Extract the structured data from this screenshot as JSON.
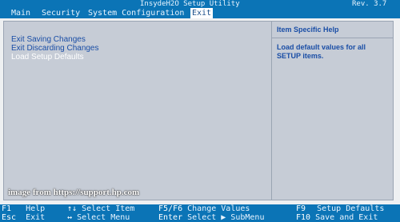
{
  "header": {
    "title": "InsydeH2O Setup Utility",
    "revision": "Rev. 3.7"
  },
  "menu": [
    "Main",
    "Security",
    "System Configuration",
    "Exit"
  ],
  "options": [
    "Exit Saving Changes",
    "Exit Discarding Changes",
    "Load Setup Defaults"
  ],
  "help": {
    "title": "Item Specific Help",
    "text": "Load default values for all SETUP items."
  },
  "watermark": "image from https://support.hp.com",
  "footer": {
    "row1": [
      {
        "key": "F1",
        "label": "Help"
      },
      {
        "key": "↑↓",
        "label": "Select Item"
      },
      {
        "key": "F5/F6",
        "label": "Change Values"
      },
      {
        "key": "F9",
        "label": "Setup Defaults"
      }
    ],
    "row2": [
      {
        "key": "Esc",
        "label": "Exit"
      },
      {
        "key": "↔",
        "label": "Select Menu"
      },
      {
        "key": "Enter",
        "label": "Select ▶ SubMenu"
      },
      {
        "key": "F10",
        "label": "Save and Exit"
      }
    ]
  },
  "colors": {
    "bar": "#0b74b6",
    "panel": "#c6ccd6",
    "accent_text": "#1a4ea6",
    "selected_text": "#ffffff"
  }
}
